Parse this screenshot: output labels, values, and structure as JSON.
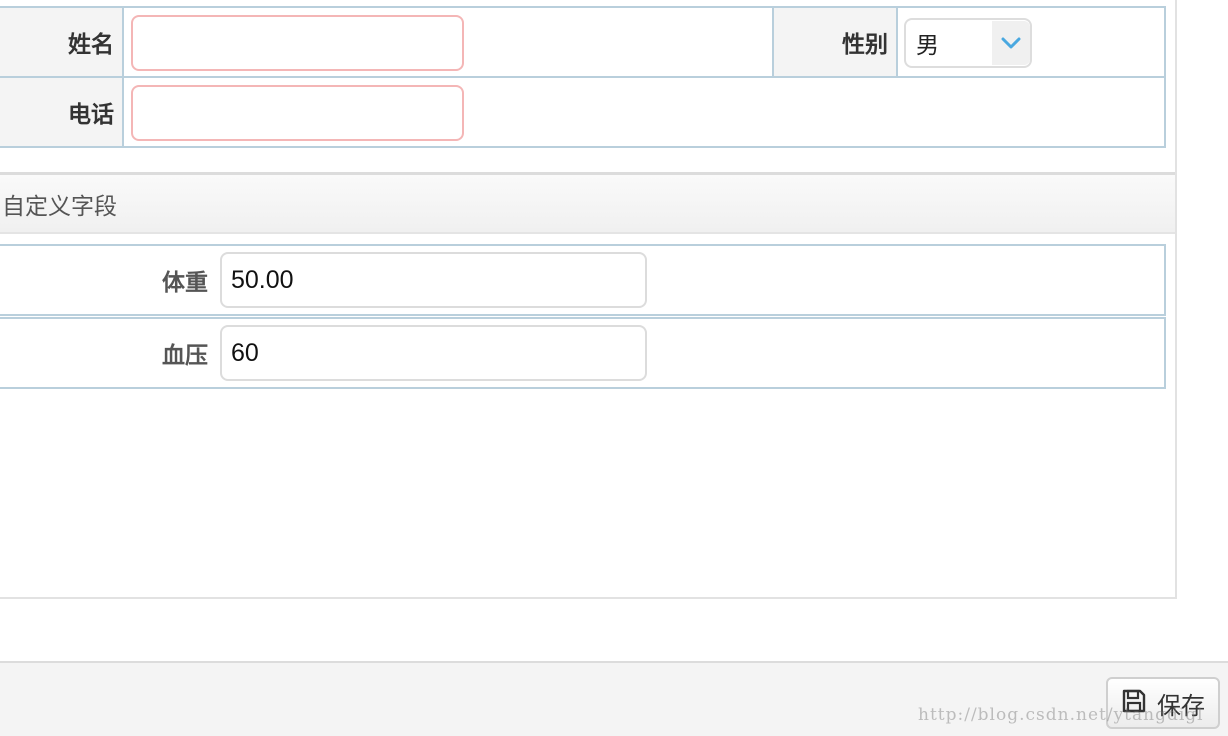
{
  "basic_info": {
    "name_label": "姓名",
    "name_value": "",
    "gender_label": "性别",
    "gender_value": "男",
    "phone_label": "电话",
    "phone_value": ""
  },
  "custom_section": {
    "title": "自定义字段",
    "fields": [
      {
        "label": "体重",
        "value": "50.00"
      },
      {
        "label": "血压",
        "value": "60"
      }
    ]
  },
  "footer": {
    "save_label": "保存"
  },
  "watermark": "http://blog.csdn.net/ytangdigl",
  "colors": {
    "table_border": "#b9cfdc",
    "required_input_border": "#f4b6b6",
    "select_arrow": "#4aa8e0"
  },
  "icons": {
    "save": "floppy-disk-icon",
    "dropdown": "chevron-down-icon"
  }
}
